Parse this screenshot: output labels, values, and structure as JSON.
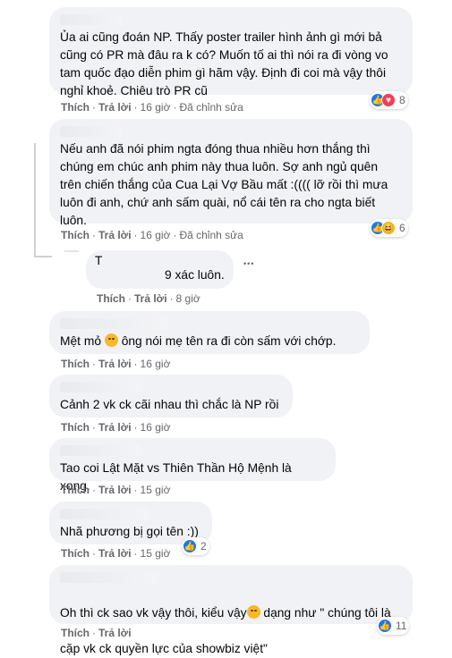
{
  "actions": {
    "like": "Thích",
    "reply": "Trả lời",
    "dot": "·",
    "edited": "Đã chỉnh sửa"
  },
  "comments": [
    {
      "text": "Ủa ai cũng đoán NP. Thấy poster trailer hình ảnh gì mới bả\ncũng có PR mà đâu ra k có? Muốn tố ai thì nói ra đi vòng vo\ntam quốc đạo diễn phim gì hãm vậy. Định đi coi mà vậy thôi\nnghỉ khoẻ. Chiêu trò PR cũ",
      "time": "16 giờ",
      "edited": true,
      "reactions": {
        "icons": [
          "like-icon",
          "love-icon"
        ],
        "count": "8"
      }
    },
    {
      "text": "Nếu anh đã nói phim ngta đóng thua nhiều hơn thắng thì\nchúng em chúc anh phim này thua luôn. Sợ anh ngủ quên\ntrên chiến thắng của Cua Lại Vợ Bầu mất :(((( lỡ rồi thì mưa\nluôn đi anh, chứ anh sấm quài, nổ cái tên ra cho ngta biết\nluôn.",
      "time": "16 giờ",
      "edited": true,
      "reactions": {
        "icons": [
          "like-icon",
          "haha-icon"
        ],
        "count": "6"
      }
    },
    {
      "author_initial": "T",
      "text": "9 xác luôn.",
      "time": "8 giờ"
    },
    {
      "text_before": "Mệt mỏ",
      "text_after": "ông nói mẹ tên ra đi còn sấm với chớp.",
      "time": "16 giờ"
    },
    {
      "text": "Cảnh 2 vk ck cãi nhau thì chắc là NP rồi",
      "time": "16 giờ"
    },
    {
      "text": "Tao coi Lật Mặt vs Thiên Thần Hộ Mệnh là xong.",
      "time": "15 giờ"
    },
    {
      "text": "Nhã phương bị gọi tên :))",
      "time": "15 giờ",
      "reactions": {
        "icons": [
          "like-icon"
        ],
        "count": "2"
      }
    },
    {
      "text_line1_before": "Oh thì ck sao vk vậy thôi, kiểu vậy",
      "text_line1_after": " dạng như \" chúng tôi là",
      "text_line2": "cặp vk ck quyền lực của showbiz việt\"",
      "reactions": {
        "icons": [
          "like-icon"
        ],
        "count": "11"
      }
    }
  ],
  "more_label": "•••"
}
